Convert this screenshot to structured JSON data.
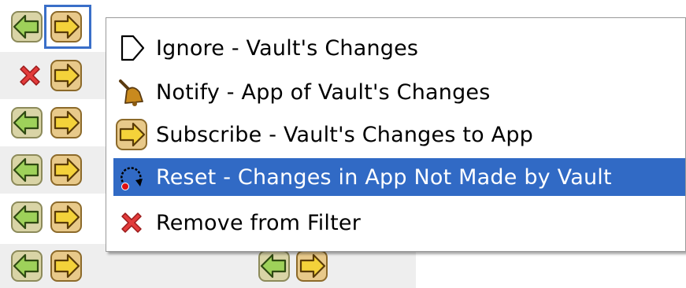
{
  "colors": {
    "highlight": "#316ac5",
    "selection_border": "#3a6fc8",
    "row_shade": "#eeeeee",
    "arrow_left_fill": "#9ed15a",
    "arrow_right_fill": "#f4d23a"
  },
  "context_menu": {
    "items": [
      {
        "label": "Ignore - Vault's Changes",
        "icon": "ignore-outline-icon"
      },
      {
        "label": "Notify - App of Vault's Changes",
        "icon": "bell-icon"
      },
      {
        "label": "Subscribe - Vault's Changes to App",
        "icon": "subscribe-arrow-icon"
      },
      {
        "label": "Reset - Changes in App Not Made by Vault",
        "icon": "reset-circular-arrow-icon",
        "highlighted": true
      },
      {
        "label": "Remove from Filter",
        "icon": "red-x-remove-icon"
      }
    ]
  },
  "grid_rows": [
    {
      "icons": [
        "sync-left-icon",
        "sync-right-icon"
      ],
      "selected": "sync-right-icon"
    },
    {
      "icons": [
        "red-x-icon",
        "sync-right-icon"
      ]
    },
    {
      "icons": [
        "sync-left-icon",
        "sync-right-icon"
      ]
    },
    {
      "icons": [
        "sync-left-icon",
        "sync-right-icon"
      ]
    },
    {
      "icons": [
        "sync-left-icon",
        "sync-right-icon"
      ]
    },
    {
      "icons": [
        "sync-left-icon",
        "sync-right-icon"
      ],
      "second_column": [
        "sync-left-icon",
        "sync-right-icon"
      ]
    }
  ]
}
